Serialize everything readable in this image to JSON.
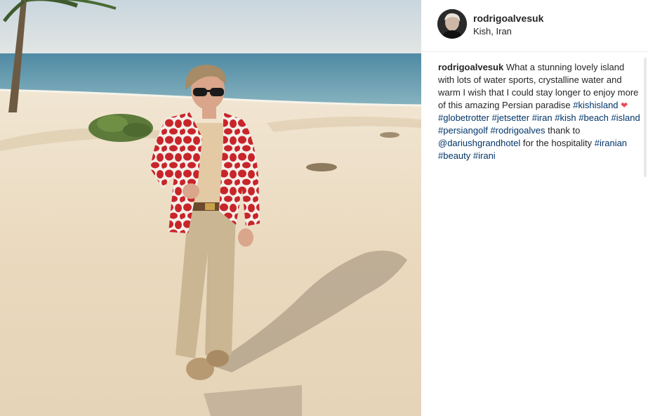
{
  "post": {
    "username": "rodrigoalvesuk",
    "location": "Kish, Iran",
    "photo_alt": "Man in red giraffe-print blazer on a sandy beach",
    "caption": {
      "author": "rodrigoalvesuk",
      "text_1": " What a stunning lovely island with lots of water sports, crystalline water and warm I wish that I could stay longer to enjoy more of this amazing Persian paradise ",
      "tag_kishisland": "#kishisland",
      "heart": "❤",
      "tag_globetrotter": "#globetrotter",
      "tag_jetsetter": "#jetsetter",
      "tag_iran": "#iran",
      "tag_kish": "#kish",
      "tag_beach": "#beach",
      "tag_island": "#island",
      "tag_persiangolf": "#persiangolf",
      "tag_rodrigoalves": "#rodrigoalves",
      "text_2": " thank to ",
      "mention_hotel": "@dariushgrandhotel",
      "text_3": " for the hospitality ",
      "tag_iranian": "#iranian",
      "tag_beauty": "#beauty",
      "tag_irani": "#irani"
    }
  },
  "colors": {
    "link": "#003569",
    "text": "#262626",
    "heart": "#ed4956",
    "sea": "#5f93aa",
    "sand": "#efe2cd",
    "blazer_red": "#c8252b"
  },
  "icons": {
    "heart": "heart-icon"
  }
}
